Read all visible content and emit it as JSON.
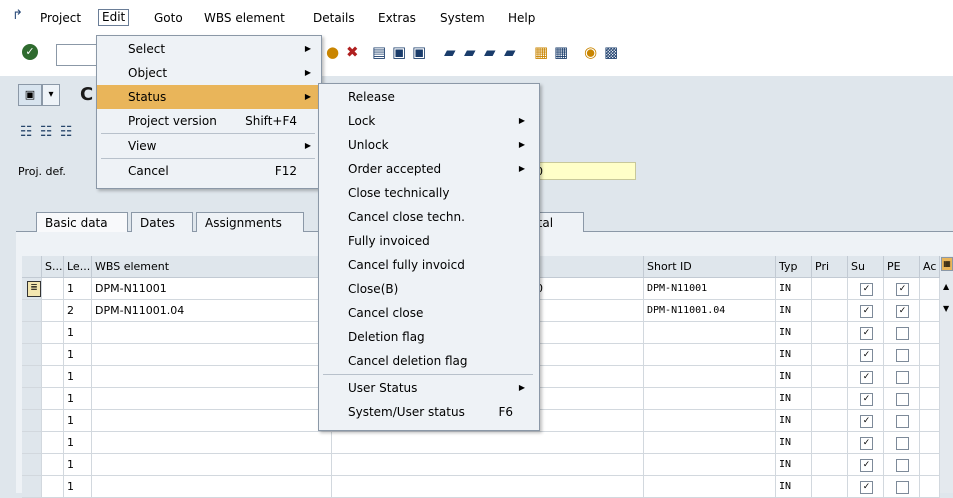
{
  "menubar": {
    "items": [
      "Project",
      "Edit",
      "Goto",
      "WBS element",
      "Details",
      "Extras",
      "System",
      "Help"
    ]
  },
  "page": {
    "title": "C",
    "proj_def_label": "Proj. def.",
    "proj_def_value": "0"
  },
  "tabs": [
    "Basic data",
    "Dates",
    "Assignments",
    "Total"
  ],
  "table": {
    "headers": [
      "S...",
      "Le...",
      "WBS element",
      "Short ID",
      "Typ",
      "Pri",
      "Su",
      "PE",
      "Ac"
    ],
    "rows": [
      {
        "level": "1",
        "wbs": "DPM-N11001",
        "desc": "360",
        "short_id": "DPM-N11001",
        "typ": "IN",
        "su": true,
        "pe": true
      },
      {
        "level": "2",
        "wbs": "DPM-N11001.04",
        "desc": "",
        "short_id": "DPM-N11001.04",
        "typ": "IN",
        "su": true,
        "pe": true
      },
      {
        "level": "1",
        "wbs": "",
        "desc": "",
        "short_id": "",
        "typ": "IN",
        "su": true,
        "pe": false
      },
      {
        "level": "1",
        "wbs": "",
        "desc": "",
        "short_id": "",
        "typ": "IN",
        "su": true,
        "pe": false
      },
      {
        "level": "1",
        "wbs": "",
        "desc": "",
        "short_id": "",
        "typ": "IN",
        "su": true,
        "pe": false
      },
      {
        "level": "1",
        "wbs": "",
        "desc": "",
        "short_id": "",
        "typ": "IN",
        "su": true,
        "pe": false
      },
      {
        "level": "1",
        "wbs": "",
        "desc": "",
        "short_id": "",
        "typ": "IN",
        "su": true,
        "pe": false
      },
      {
        "level": "1",
        "wbs": "",
        "desc": "",
        "short_id": "",
        "typ": "IN",
        "su": true,
        "pe": false
      },
      {
        "level": "1",
        "wbs": "",
        "desc": "",
        "short_id": "",
        "typ": "IN",
        "su": true,
        "pe": false
      },
      {
        "level": "1",
        "wbs": "",
        "desc": "",
        "short_id": "",
        "typ": "IN",
        "su": true,
        "pe": false
      }
    ]
  },
  "edit_menu": {
    "items": [
      {
        "label": "Select",
        "shortcut": "",
        "submenu": true
      },
      {
        "label": "Object",
        "shortcut": "",
        "submenu": true
      },
      {
        "label": "Status",
        "shortcut": "",
        "submenu": true
      },
      {
        "label": "Project version",
        "shortcut": "Shift+F4",
        "submenu": false
      },
      {
        "label": "View",
        "shortcut": "",
        "submenu": true
      },
      {
        "label": "Cancel",
        "shortcut": "F12",
        "submenu": false
      }
    ]
  },
  "status_menu": {
    "items": [
      {
        "label": "Release",
        "shortcut": "",
        "submenu": false
      },
      {
        "label": "Lock",
        "shortcut": "",
        "submenu": true
      },
      {
        "label": "Unlock",
        "shortcut": "",
        "submenu": true
      },
      {
        "label": "Order accepted",
        "shortcut": "",
        "submenu": true
      },
      {
        "label": "Close technically",
        "shortcut": "",
        "submenu": false
      },
      {
        "label": "Cancel close techn.",
        "shortcut": "",
        "submenu": false
      },
      {
        "label": "Fully invoiced",
        "shortcut": "",
        "submenu": false
      },
      {
        "label": "Cancel fully invoicd",
        "shortcut": "",
        "submenu": false
      },
      {
        "label": "Close(B)",
        "shortcut": "",
        "submenu": false
      },
      {
        "label": "Cancel close",
        "shortcut": "",
        "submenu": false
      },
      {
        "label": "Deletion flag",
        "shortcut": "",
        "submenu": false
      },
      {
        "label": "Cancel deletion flag",
        "shortcut": "",
        "submenu": false
      },
      {
        "label": "User Status",
        "shortcut": "",
        "submenu": true
      },
      {
        "label": "System/User status",
        "shortcut": "F6",
        "submenu": false
      }
    ]
  },
  "colors": {
    "highlight": "#e9b55a",
    "background": "#dfe6ec",
    "required_field": "#ffffc8"
  }
}
